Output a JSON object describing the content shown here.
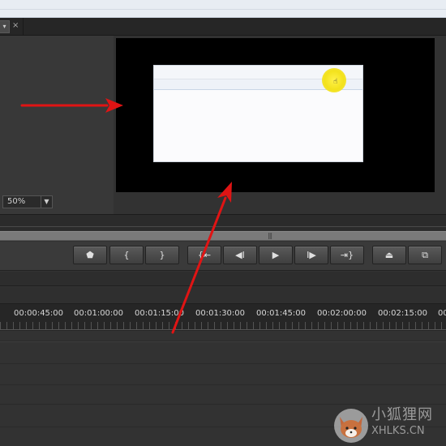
{
  "panel_tab": {
    "dropdown_glyph": "▾",
    "close_glyph": "×"
  },
  "monitor": {
    "zoom": "50%",
    "zoom_arrow": "▼",
    "cursor_glyph": "☝"
  },
  "transport": {
    "buttons": [
      {
        "name": "add-marker-button",
        "icon": "marker-icon",
        "glyph": "⬟"
      },
      {
        "name": "mark-in-button",
        "icon": "mark-in-icon",
        "glyph": "{"
      },
      {
        "name": "mark-out-button",
        "icon": "mark-out-icon",
        "glyph": "}"
      },
      {
        "name": "go-to-in-button",
        "icon": "go-to-in-icon",
        "glyph": "{⇤"
      },
      {
        "name": "step-back-button",
        "icon": "step-back-icon",
        "glyph": "◀Ι"
      },
      {
        "name": "play-button",
        "icon": "play-icon",
        "glyph": "▶"
      },
      {
        "name": "step-forward-button",
        "icon": "step-forward-icon",
        "glyph": "Ι▶"
      },
      {
        "name": "go-to-out-button",
        "icon": "go-to-out-icon",
        "glyph": "⇥}"
      },
      {
        "name": "lift-button",
        "icon": "lift-icon",
        "glyph": "⏏"
      },
      {
        "name": "extract-button",
        "icon": "extract-icon",
        "glyph": "⧉"
      }
    ]
  },
  "timeline": {
    "timecodes": [
      "00:00:45:00",
      "00:01:00:00",
      "00:01:15:00",
      "00:01:30:00",
      "00:01:45:00",
      "00:02:00:00",
      "00:02:15:00",
      "00:"
    ]
  },
  "annotations": {
    "arrow_color": "#e01414"
  },
  "watermark": {
    "brand_cn": "小狐狸网",
    "domain": "XHLKS.CN"
  },
  "colors": {
    "panel_bg": "#323232",
    "cursor_highlight": "#f3e21c"
  }
}
